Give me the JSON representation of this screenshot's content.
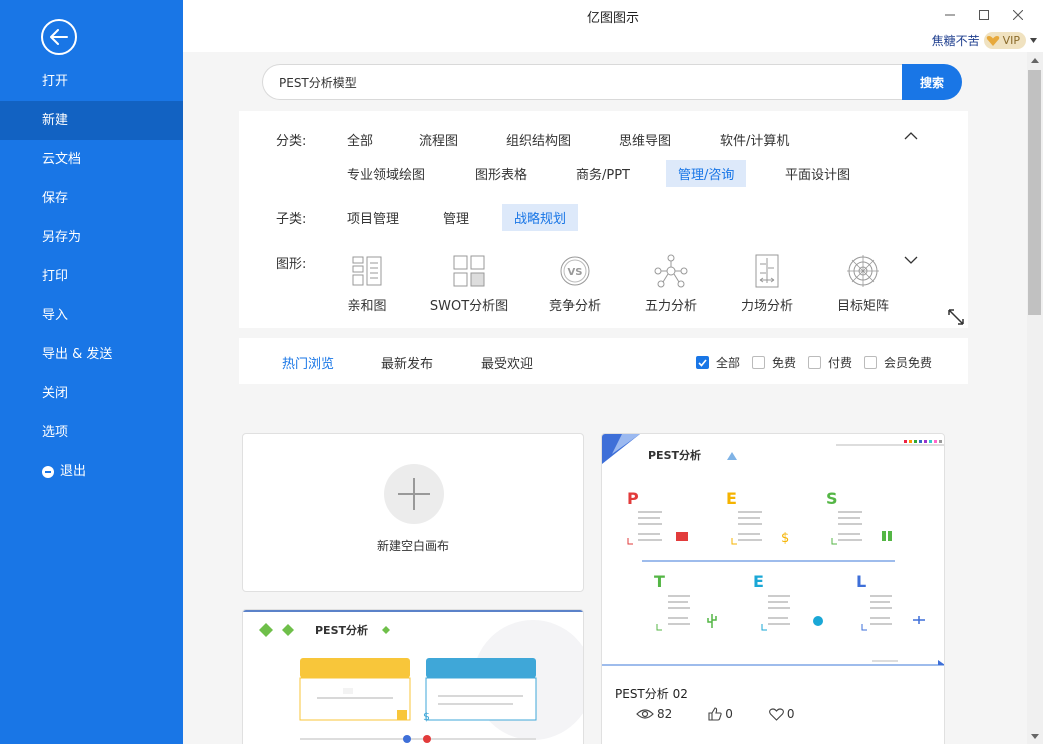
{
  "window": {
    "title": "亿图图示",
    "minimize": "—",
    "maximize": "☐",
    "close": "✕"
  },
  "user": {
    "name": "焦糖不苦",
    "vip_label": "VIP"
  },
  "sidebar": {
    "items": [
      {
        "label": "打开"
      },
      {
        "label": "新建",
        "active": true
      },
      {
        "label": "云文档"
      },
      {
        "label": "保存"
      },
      {
        "label": "另存为"
      },
      {
        "label": "打印"
      },
      {
        "label": "导入"
      },
      {
        "label": "导出 & 发送"
      },
      {
        "label": "关闭"
      },
      {
        "label": "选项"
      },
      {
        "label": "退出"
      }
    ]
  },
  "search": {
    "value": "PEST分析模型",
    "button": "搜索"
  },
  "filters": {
    "category_label": "分类:",
    "categories": [
      "全部",
      "流程图",
      "组织结构图",
      "思维导图",
      "软件/计算机",
      "专业领域绘图",
      "图形表格",
      "商务/PPT",
      "管理/咨询",
      "平面设计图"
    ],
    "active_category": "管理/咨询",
    "sub_label": "子类:",
    "subcategories": [
      "项目管理",
      "管理",
      "战略规划"
    ],
    "active_sub": "战略规划",
    "shape_label": "图形:",
    "shapes": [
      {
        "label": "亲和图",
        "icon": "affinity-diagram-icon"
      },
      {
        "label": "SWOT分析图",
        "icon": "swot-grid-icon"
      },
      {
        "label": "竞争分析",
        "icon": "versus-icon"
      },
      {
        "label": "五力分析",
        "icon": "five-forces-icon"
      },
      {
        "label": "力场分析",
        "icon": "force-field-icon"
      },
      {
        "label": "目标矩阵",
        "icon": "target-matrix-icon"
      }
    ]
  },
  "sort": {
    "tabs": [
      "热门浏览",
      "最新发布",
      "最受欢迎"
    ],
    "active_tab": "热门浏览",
    "checks": [
      {
        "label": "全部",
        "checked": true
      },
      {
        "label": "免费",
        "checked": false
      },
      {
        "label": "付费",
        "checked": false
      },
      {
        "label": "会员免费",
        "checked": false
      }
    ]
  },
  "cards": {
    "new_blank": "新建空白画布",
    "template1": {
      "name": "PEST分析 02",
      "views": "82",
      "likes": "0",
      "favorites": "0",
      "preview_title": "PEST分析"
    },
    "template2": {
      "preview_title": "PEST分析"
    }
  },
  "colors": {
    "primary": "#1976e6",
    "sidebar_active": "#1262c2",
    "chip_active_bg": "#dde9fa"
  }
}
